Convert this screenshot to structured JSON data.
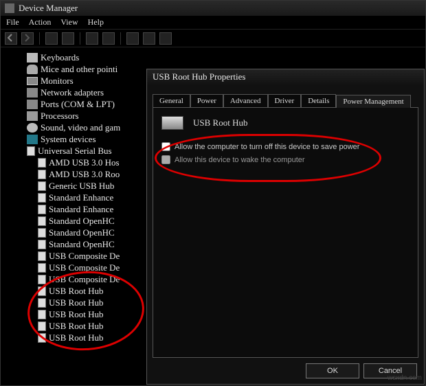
{
  "window": {
    "title": "Device Manager"
  },
  "menu": {
    "file": "File",
    "action": "Action",
    "view": "View",
    "help": "Help"
  },
  "tree": {
    "items": [
      "Keyboards",
      "Mice and other pointi",
      "Monitors",
      "Network adapters",
      "Ports (COM & LPT)",
      "Processors",
      "Sound, video and gam",
      "System devices",
      "Universal Serial Bus"
    ],
    "usb_children": [
      "AMD USB 3.0 Hos",
      "AMD USB 3.0 Roo",
      "Generic USB Hub",
      "Standard Enhance",
      "Standard Enhance",
      "Standard OpenHC",
      "Standard OpenHC",
      "Standard OpenHC",
      "USB Composite De",
      "USB Composite De",
      "USB Composite De",
      "USB Root Hub",
      "USB Root Hub",
      "USB Root Hub",
      "USB Root Hub",
      "USB Root Hub"
    ]
  },
  "dialog": {
    "title": "USB Root Hub Properties",
    "tabs": {
      "general": "General",
      "power": "Power",
      "advanced": "Advanced",
      "driver": "Driver",
      "details": "Details",
      "power_mgmt": "Power Management"
    },
    "device_name": "USB Root Hub",
    "chk1": "Allow the computer to turn off this device to save power",
    "chk2": "Allow this device to wake the computer",
    "ok": "OK",
    "cancel": "Cancel"
  },
  "watermark": "wsxdn.com"
}
